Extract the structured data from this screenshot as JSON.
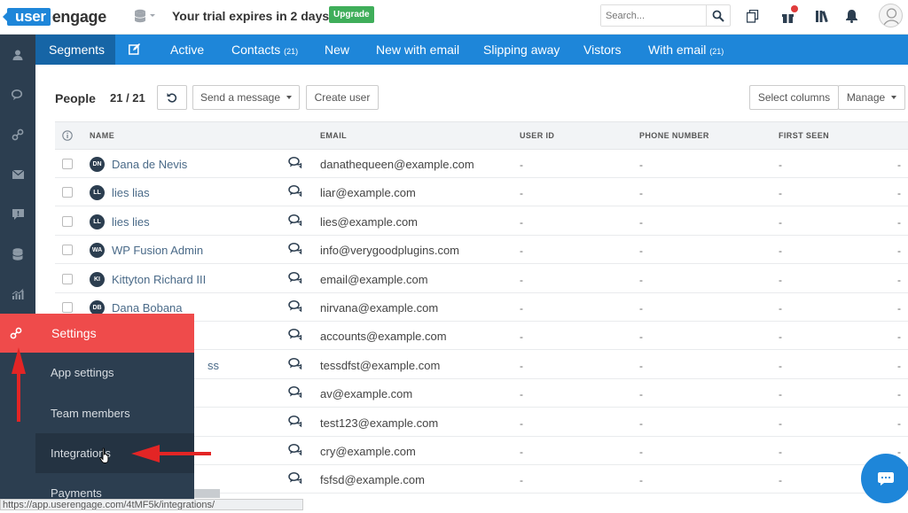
{
  "topbar": {
    "logo_user": "user",
    "logo_engage": "engage",
    "trial_text": "Your trial expires in 2 days.",
    "upgrade_label": "Upgrade",
    "search_placeholder": "Search..."
  },
  "nav": {
    "tabs": [
      {
        "label": "Segments",
        "count": ""
      },
      {
        "label": "Active",
        "count": ""
      },
      {
        "label": "Contacts",
        "count": "(21)"
      },
      {
        "label": "New",
        "count": ""
      },
      {
        "label": "New with email",
        "count": ""
      },
      {
        "label": "Slipping away",
        "count": ""
      },
      {
        "label": "Vistors",
        "count": ""
      },
      {
        "label": "With email",
        "count": "(21)"
      }
    ]
  },
  "toolbar": {
    "title": "People",
    "count": "21 / 21",
    "send_message": "Send a message",
    "create_user": "Create user",
    "select_columns": "Select columns",
    "manage": "Manage"
  },
  "table": {
    "headers": {
      "name": "NAME",
      "email": "EMAIL",
      "user_id": "USER ID",
      "phone": "PHONE NUMBER",
      "first_seen": "FIRST SEEN"
    },
    "rows": [
      {
        "initials": "DN",
        "name": "Dana de Nevis",
        "email": "danathequeen@example.com",
        "user_id": "-",
        "phone": "-",
        "first_seen": "-",
        "extra": "-"
      },
      {
        "initials": "LL",
        "name": "lies lias",
        "email": "liar@example.com",
        "user_id": "-",
        "phone": "-",
        "first_seen": "-",
        "extra": "-"
      },
      {
        "initials": "LL",
        "name": "lies lies",
        "email": "lies@example.com",
        "user_id": "-",
        "phone": "-",
        "first_seen": "-",
        "extra": "-"
      },
      {
        "initials": "WA",
        "name": "WP Fusion Admin",
        "email": "info@verygoodplugins.com",
        "user_id": "-",
        "phone": "-",
        "first_seen": "-",
        "extra": "-"
      },
      {
        "initials": "KI",
        "name": "Kittyton Richard III",
        "email": "email@example.com",
        "user_id": "-",
        "phone": "-",
        "first_seen": "-",
        "extra": "-"
      },
      {
        "initials": "DB",
        "name": "Dana Bobana",
        "email": "nirvana@example.com",
        "user_id": "-",
        "phone": "-",
        "first_seen": "-",
        "extra": "-"
      },
      {
        "initials": "",
        "name": "",
        "email": "accounts@example.com",
        "user_id": "-",
        "phone": "-",
        "first_seen": "-",
        "extra": "-"
      },
      {
        "initials": "",
        "name": "ss",
        "email": "tessdfst@example.com",
        "user_id": "-",
        "phone": "-",
        "first_seen": "-",
        "extra": "-"
      },
      {
        "initials": "",
        "name": "",
        "email": "av@example.com",
        "user_id": "-",
        "phone": "-",
        "first_seen": "-",
        "extra": "-"
      },
      {
        "initials": "",
        "name": "",
        "email": "test123@example.com",
        "user_id": "-",
        "phone": "-",
        "first_seen": "-",
        "extra": "-"
      },
      {
        "initials": "",
        "name": "",
        "email": "cry@example.com",
        "user_id": "-",
        "phone": "-",
        "first_seen": "-",
        "extra": "-"
      },
      {
        "initials": "",
        "name": "",
        "email": "fsfsd@example.com",
        "user_id": "-",
        "phone": "-",
        "first_seen": "-",
        "extra": "-"
      }
    ]
  },
  "settings_menu": {
    "title": "Settings",
    "items": [
      "App settings",
      "Team members",
      "Integrations",
      "Payments"
    ]
  },
  "statusbar": {
    "url": "https://app.userengage.com/4tMF5k/integrations/"
  },
  "colors": {
    "brand_blue": "#1e86d9",
    "settings_red": "#ef4b4b",
    "sidebar_dark": "#2c3e50",
    "upgrade_green": "#3fae5a"
  }
}
